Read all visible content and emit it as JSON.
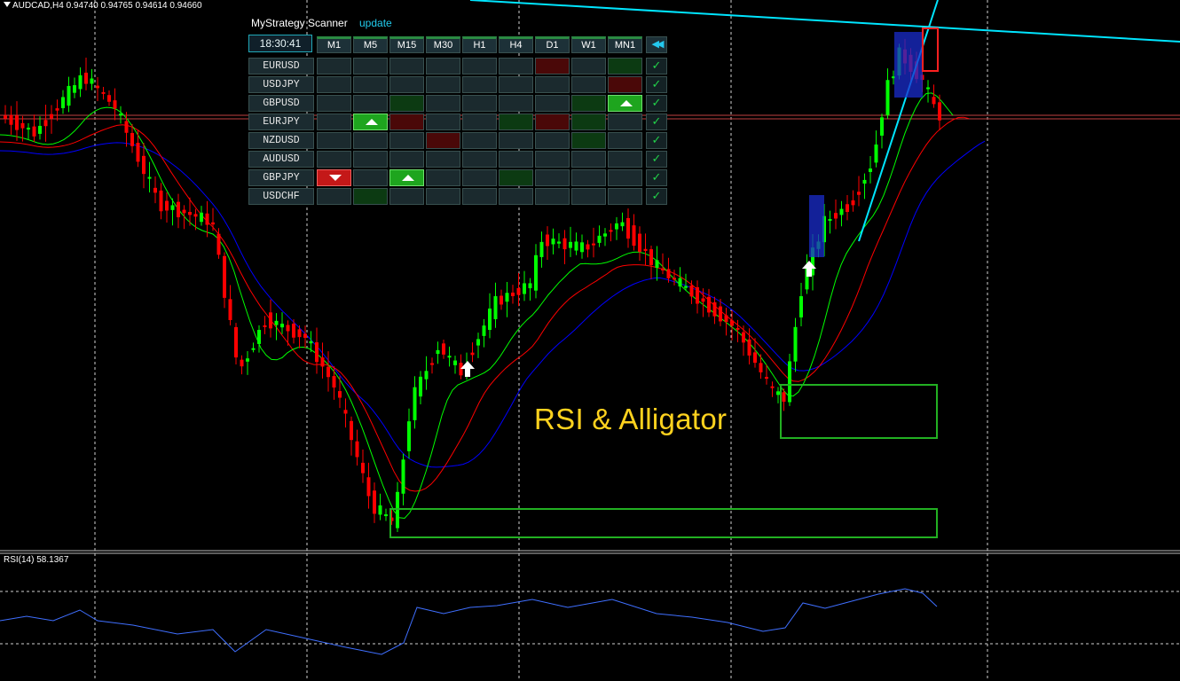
{
  "chart_header": {
    "symbol_timeframe": "AUDCAD,H4",
    "open": "0.94740",
    "high": "0.94765",
    "low": "0.94614",
    "close": "0.94660"
  },
  "rsi_header": {
    "label": "RSI(14)",
    "value": "58.1367"
  },
  "annotation": {
    "title": "RSI & Alligator"
  },
  "scanner": {
    "title": "MyStrategy Scanner",
    "update_label": "update",
    "clock": "18:30:41",
    "rewind_icon": "rewind-icon",
    "timeframes": [
      "M1",
      "M5",
      "M15",
      "M30",
      "H1",
      "H4",
      "D1",
      "W1",
      "MN1"
    ],
    "rows": [
      {
        "symbol": "EURUSD",
        "cells": [
          "n",
          "n",
          "n",
          "n",
          "n",
          "n",
          "dr",
          "n",
          "dg"
        ]
      },
      {
        "symbol": "USDJPY",
        "cells": [
          "n",
          "n",
          "n",
          "n",
          "n",
          "n",
          "n",
          "n",
          "dr"
        ]
      },
      {
        "symbol": "GBPUSD",
        "cells": [
          "n",
          "n",
          "dg",
          "n",
          "n",
          "n",
          "n",
          "dg",
          "up"
        ]
      },
      {
        "symbol": "EURJPY",
        "cells": [
          "n",
          "up",
          "dr",
          "n",
          "n",
          "dg",
          "dr",
          "dg",
          "n"
        ]
      },
      {
        "symbol": "NZDUSD",
        "cells": [
          "n",
          "n",
          "n",
          "dr",
          "n",
          "n",
          "n",
          "dg",
          "n"
        ]
      },
      {
        "symbol": "AUDUSD",
        "cells": [
          "n",
          "n",
          "n",
          "n",
          "n",
          "n",
          "n",
          "n",
          "n"
        ]
      },
      {
        "symbol": "GBPJPY",
        "cells": [
          "down",
          "n",
          "up",
          "n",
          "n",
          "dg",
          "n",
          "n",
          "n"
        ]
      },
      {
        "symbol": "USDCHF",
        "cells": [
          "n",
          "dg",
          "n",
          "n",
          "n",
          "n",
          "n",
          "n",
          "n"
        ]
      }
    ]
  },
  "colors": {
    "bull_candle": "#00ff00",
    "bear_candle": "#ff0000",
    "alligator_jaw": "#0000ff",
    "alligator_teeth": "#ff0000",
    "alligator_lips": "#00ff00",
    "trendline": "#00e5ff",
    "rsi_line": "#3f6fff",
    "title_color": "#ffd21e",
    "check_color": "#22d24a"
  }
}
